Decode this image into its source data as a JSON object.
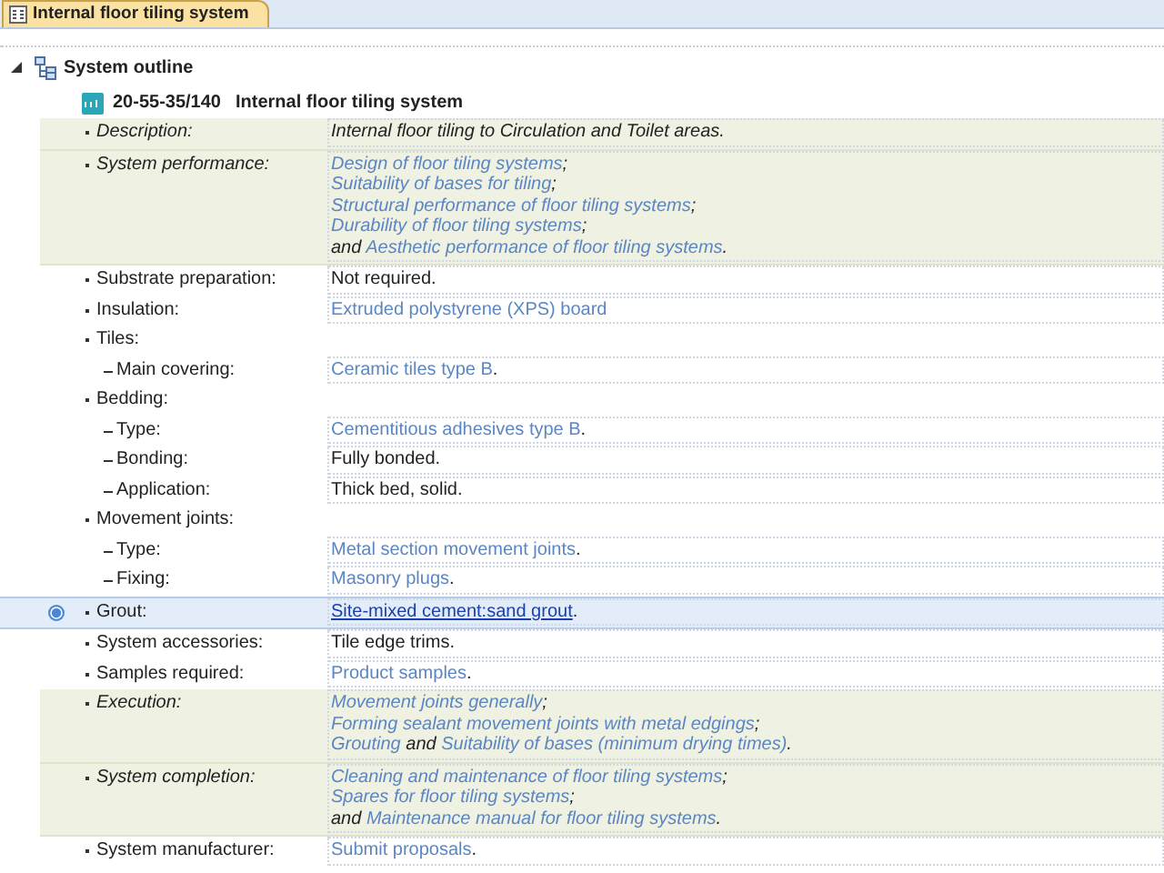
{
  "tab": {
    "label": "Internal floor tiling system",
    "selected": true
  },
  "outline": {
    "title": "System outline",
    "expanded": true
  },
  "system": {
    "code": "20-55-35/140",
    "title": "Internal floor tiling system"
  },
  "rows": [
    {
      "kind": "bullet",
      "label": "Description:",
      "shaded": true,
      "hovered": false,
      "lines": [
        [
          {
            "text": "Internal floor tiling to Circulation and Toilet areas.",
            "link": false
          }
        ]
      ]
    },
    {
      "kind": "bullet",
      "label": "System performance:",
      "shaded": true,
      "hovered": false,
      "lines": [
        [
          {
            "text": "Design of floor tiling systems",
            "link": true
          },
          {
            "text": ";",
            "link": false
          }
        ],
        [
          {
            "text": "Suitability of bases for tiling",
            "link": true
          },
          {
            "text": ";",
            "link": false
          }
        ],
        [
          {
            "text": "Structural performance of floor tiling systems",
            "link": true
          },
          {
            "text": ";",
            "link": false
          }
        ],
        [
          {
            "text": "Durability of floor tiling systems",
            "link": true
          },
          {
            "text": ";",
            "link": false
          }
        ],
        [
          {
            "text": "and ",
            "link": false
          },
          {
            "text": "Aesthetic performance of floor tiling systems",
            "link": true
          },
          {
            "text": ".",
            "link": false
          }
        ]
      ]
    },
    {
      "kind": "bullet",
      "label": "Substrate preparation:",
      "shaded": false,
      "hovered": false,
      "lines": [
        [
          {
            "text": "Not required.",
            "link": false
          }
        ]
      ]
    },
    {
      "kind": "bullet",
      "label": "Insulation:",
      "shaded": false,
      "hovered": false,
      "lines": [
        [
          {
            "text": "Extruded polystyrene (XPS) board",
            "link": true
          }
        ]
      ]
    },
    {
      "kind": "bullet",
      "label": "Tiles:",
      "shaded": false,
      "hovered": false,
      "lines": []
    },
    {
      "kind": "dash",
      "label": "Main covering:",
      "shaded": false,
      "hovered": false,
      "lines": [
        [
          {
            "text": "Ceramic tiles type B",
            "link": true
          },
          {
            "text": ".",
            "link": false
          }
        ]
      ]
    },
    {
      "kind": "bullet",
      "label": "Bedding:",
      "shaded": false,
      "hovered": false,
      "lines": []
    },
    {
      "kind": "dash",
      "label": "Type:",
      "shaded": false,
      "hovered": false,
      "lines": [
        [
          {
            "text": "Cementitious adhesives type B",
            "link": true
          },
          {
            "text": ".",
            "link": false
          }
        ]
      ]
    },
    {
      "kind": "dash",
      "label": "Bonding:",
      "shaded": false,
      "hovered": false,
      "lines": [
        [
          {
            "text": "Fully bonded.",
            "link": false
          }
        ]
      ]
    },
    {
      "kind": "dash",
      "label": "Application:",
      "shaded": false,
      "hovered": false,
      "lines": [
        [
          {
            "text": "Thick bed, solid.",
            "link": false
          }
        ]
      ]
    },
    {
      "kind": "bullet",
      "label": "Movement joints:",
      "shaded": false,
      "hovered": false,
      "lines": []
    },
    {
      "kind": "dash",
      "label": "Type:",
      "shaded": false,
      "hovered": false,
      "lines": [
        [
          {
            "text": "Metal section movement joints",
            "link": true
          },
          {
            "text": ".",
            "link": false
          }
        ]
      ]
    },
    {
      "kind": "dash",
      "label": "Fixing:",
      "shaded": false,
      "hovered": false,
      "lines": [
        [
          {
            "text": "Masonry plugs",
            "link": true
          },
          {
            "text": ".",
            "link": false
          }
        ]
      ]
    },
    {
      "kind": "bullet",
      "label": "Grout:",
      "shaded": false,
      "hovered": true,
      "lines": [
        [
          {
            "text": "Site-mixed cement:sand grout",
            "link": true
          },
          {
            "text": ".",
            "link": false
          }
        ]
      ]
    },
    {
      "kind": "bullet",
      "label": "System accessories:",
      "shaded": false,
      "hovered": false,
      "lines": [
        [
          {
            "text": "Tile edge trims.",
            "link": false
          }
        ]
      ]
    },
    {
      "kind": "bullet",
      "label": "Samples required:",
      "shaded": false,
      "hovered": false,
      "lines": [
        [
          {
            "text": "Product samples",
            "link": true
          },
          {
            "text": ".",
            "link": false
          }
        ]
      ]
    },
    {
      "kind": "bullet",
      "label": "Execution:",
      "shaded": true,
      "hovered": false,
      "lines": [
        [
          {
            "text": "Movement joints generally",
            "link": true
          },
          {
            "text": ";",
            "link": false
          }
        ],
        [
          {
            "text": "Forming sealant movement joints with metal edgings",
            "link": true
          },
          {
            "text": ";",
            "link": false
          }
        ],
        [
          {
            "text": "Grouting",
            "link": true
          },
          {
            "text": " and ",
            "link": false
          },
          {
            "text": "Suitability of bases (minimum drying times)",
            "link": true
          },
          {
            "text": ".",
            "link": false
          }
        ]
      ]
    },
    {
      "kind": "bullet",
      "label": "System completion:",
      "shaded": true,
      "hovered": false,
      "lines": [
        [
          {
            "text": "Cleaning and maintenance of floor tiling systems",
            "link": true
          },
          {
            "text": ";",
            "link": false
          }
        ],
        [
          {
            "text": "Spares for floor tiling systems",
            "link": true
          },
          {
            "text": ";",
            "link": false
          }
        ],
        [
          {
            "text": "and ",
            "link": false
          },
          {
            "text": "Maintenance manual for floor tiling systems",
            "link": true
          },
          {
            "text": ".",
            "link": false
          }
        ]
      ]
    },
    {
      "kind": "bullet",
      "label": "System manufacturer:",
      "shaded": false,
      "hovered": false,
      "lines": [
        [
          {
            "text": "Submit proposals",
            "link": true
          },
          {
            "text": ".",
            "link": false
          }
        ]
      ]
    }
  ]
}
